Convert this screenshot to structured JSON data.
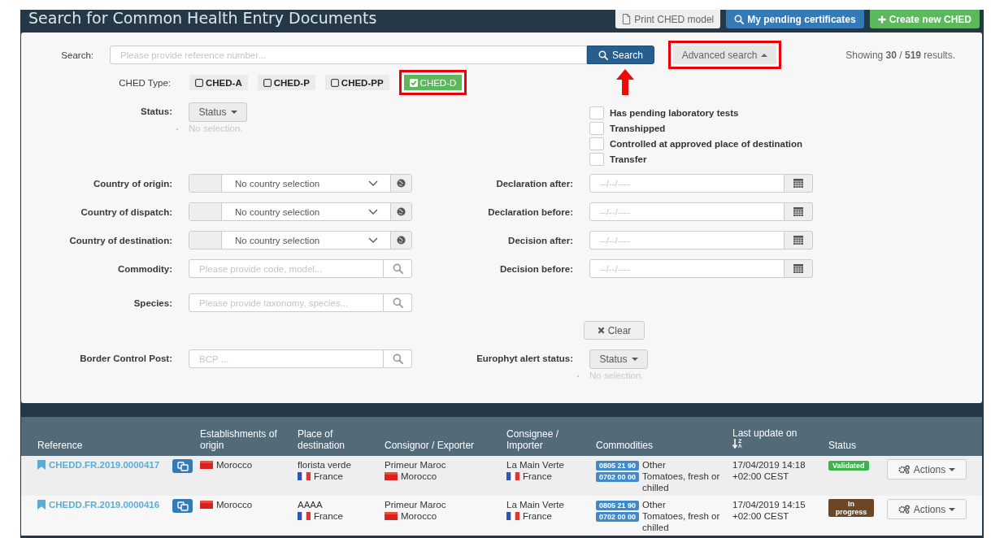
{
  "header": {
    "title": "Search for Common Health Entry Documents",
    "buttons": [
      {
        "label": "Print CHED model",
        "kind": "print"
      },
      {
        "label": "My pending certificates",
        "kind": "pending"
      },
      {
        "label": "Create new CHED",
        "kind": "create"
      }
    ]
  },
  "search": {
    "label": "Search:",
    "placeholder": "Please provide reference number...",
    "button": "Search",
    "advanced_button": {
      "label": "Advanced search",
      "highlighted": true
    },
    "results": "Showing **30** / **519** results."
  },
  "ched_type": {
    "label": "CHED Type:",
    "options": [
      {
        "label": "CHED-A",
        "selected": false
      },
      {
        "label": "CHED-P",
        "selected": false
      },
      {
        "label": "CHED-PP",
        "selected": false
      },
      {
        "label": "CHED-D",
        "selected": true,
        "highlighted": true
      }
    ]
  },
  "status_filter": {
    "label": "Status:",
    "button": "Status",
    "note": "No selection."
  },
  "flags": [
    {
      "label": "Has pending laboratory tests",
      "checked": false
    },
    {
      "label": "Transhipped",
      "checked": false
    },
    {
      "label": "Controlled at approved place of destination",
      "checked": false
    },
    {
      "label": "Transfer",
      "checked": false
    }
  ],
  "left_fields": [
    {
      "label": "Country of origin:",
      "kind": "country",
      "value": "No country selection"
    },
    {
      "label": "Country of dispatch:",
      "kind": "country",
      "value": "No country selection"
    },
    {
      "label": "Country of destination:",
      "kind": "country",
      "value": "No country selection"
    },
    {
      "label": "Commodity:",
      "kind": "lookup",
      "placeholder": "Please provide code, model..."
    },
    {
      "label": "Species:",
      "kind": "lookup",
      "placeholder": "Please provide taxonomy, species..."
    }
  ],
  "right_fields": [
    {
      "label": "Declaration after:",
      "kind": "date",
      "placeholder": "--/--/----"
    },
    {
      "label": "Declaration before:",
      "kind": "date",
      "placeholder": "--/--/----"
    },
    {
      "label": "Decision after:",
      "kind": "date",
      "placeholder": "--/--/----"
    },
    {
      "label": "Decision before:",
      "kind": "date",
      "placeholder": "--/--/----"
    }
  ],
  "clear_button": "Clear",
  "border_post": {
    "label": "Border Control Post:",
    "placeholder": "BCP ..."
  },
  "europhyt": {
    "label": "Europhyt alert status:",
    "button": "Status",
    "note": "No selection."
  },
  "table": {
    "columns": [
      "Reference",
      "Establishments of origin",
      "Place of destination",
      "Consignor / Exporter",
      "Consignee / Importer",
      "Commodities",
      "Last update on",
      "Status"
    ],
    "rows": [
      {
        "reference": "CHEDD.FR.2019.0000417",
        "establishment": {
          "country": "Morocco",
          "kind": "ma"
        },
        "destination": {
          "name": "florista verde",
          "country": "France",
          "kind": "fr"
        },
        "consignor": {
          "name": "Primeur Maroc",
          "country": "Morocco",
          "kind": "ma"
        },
        "consignee": {
          "name": "La Main Verte",
          "country": "France",
          "kind": "fr"
        },
        "commodities": [
          {
            "code": "0805 21 90",
            "description": "Other"
          },
          {
            "code": "0702 00 00",
            "description": "Tomatoes, fresh or chilled"
          }
        ],
        "updated": "17/04/2019 14:18 +02:00 CEST",
        "status": {
          "label": "Validated",
          "color": "#3cb44b"
        },
        "actions": "Actions"
      },
      {
        "reference": "CHEDD.FR.2019.0000416",
        "establishment": {
          "country": "Morocco",
          "kind": "ma"
        },
        "destination": {
          "name": "AAAA",
          "country": "France",
          "kind": "fr"
        },
        "consignor": {
          "name": "Primeur Maroc",
          "country": "Morocco",
          "kind": "ma"
        },
        "consignee": {
          "name": "La Main Verte",
          "country": "France",
          "kind": "fr"
        },
        "commodities": [
          {
            "code": "0805 21 90",
            "description": "Other"
          },
          {
            "code": "0702 00 00",
            "description": "Tomatoes, fresh or chilled"
          }
        ],
        "updated": "17/04/2019 14:15 +02:00 CEST",
        "status": {
          "label": "In progress",
          "color": "#6b4726"
        },
        "actions": "Actions"
      }
    ]
  }
}
